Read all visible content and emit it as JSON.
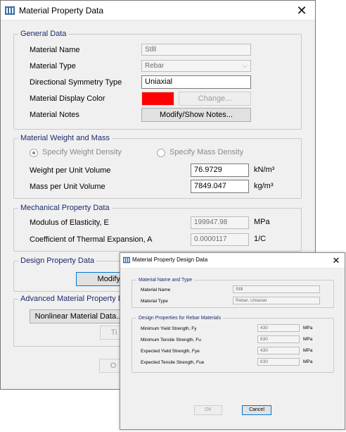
{
  "main_dialog": {
    "title": "Material Property Data",
    "close_glyph": "✕",
    "general": {
      "title": "General Data",
      "name_label": "Material Name",
      "name_value": "Stlll",
      "type_label": "Material Type",
      "type_value": "Rebar",
      "symmetry_label": "Directional Symmetry Type",
      "symmetry_value": "Uniaxial",
      "color_label": "Material Display Color",
      "color_value": "#ff0000",
      "change_button": "Change...",
      "notes_label": "Material Notes",
      "notes_button": "Modify/Show Notes..."
    },
    "weight": {
      "title": "Material Weight and Mass",
      "option_weight": "Specify Weight Density",
      "option_mass": "Specify Mass Density",
      "selected": "Specify Weight Density",
      "weight_label": "Weight per Unit Volume",
      "weight_value": "76.9729",
      "weight_unit": "kN/m³",
      "mass_label": "Mass per Unit Volume",
      "mass_value": "7849.047",
      "mass_unit": "kg/m³"
    },
    "mechanical": {
      "title": "Mechanical Property Data",
      "modulus_label": "Modulus of Elasticity,  E",
      "modulus_value": "199947.98",
      "modulus_unit": "MPa",
      "thermal_label": "Coefficient of Thermal Expansion,  A",
      "thermal_value": "0.0000117",
      "thermal_unit": "1/C"
    },
    "design": {
      "title": "Design Property Data",
      "button": "Modify/Sh"
    },
    "advanced": {
      "title": "Advanced Material Property Data",
      "nonlinear_button": "Nonlinear Material Data...",
      "time_button": "Ti"
    },
    "ok_button": "O"
  },
  "design_dialog": {
    "title": "Material Property Design Data",
    "close_glyph": "✕",
    "name_group": {
      "title": "Material Name and Type",
      "name_label": "Material Name",
      "name_value": "Stlll",
      "type_label": "Material Type",
      "type_value": "Rebar, Uniaxial"
    },
    "rebar_group": {
      "title": "Design Properties for Rebar Materials",
      "rows": [
        {
          "label": "Minimum Yield Strength, Fy",
          "value": "430",
          "unit": "MPa"
        },
        {
          "label": "Minimum Tensile Strength, Fu",
          "value": "630",
          "unit": "MPa"
        },
        {
          "label": "Expected Yield Strength, Fye",
          "value": "430",
          "unit": "MPa"
        },
        {
          "label": "Expected Tensile Strength, Fue",
          "value": "630",
          "unit": "MPa"
        }
      ]
    },
    "ok_button": "OK",
    "cancel_button": "Cancel"
  }
}
